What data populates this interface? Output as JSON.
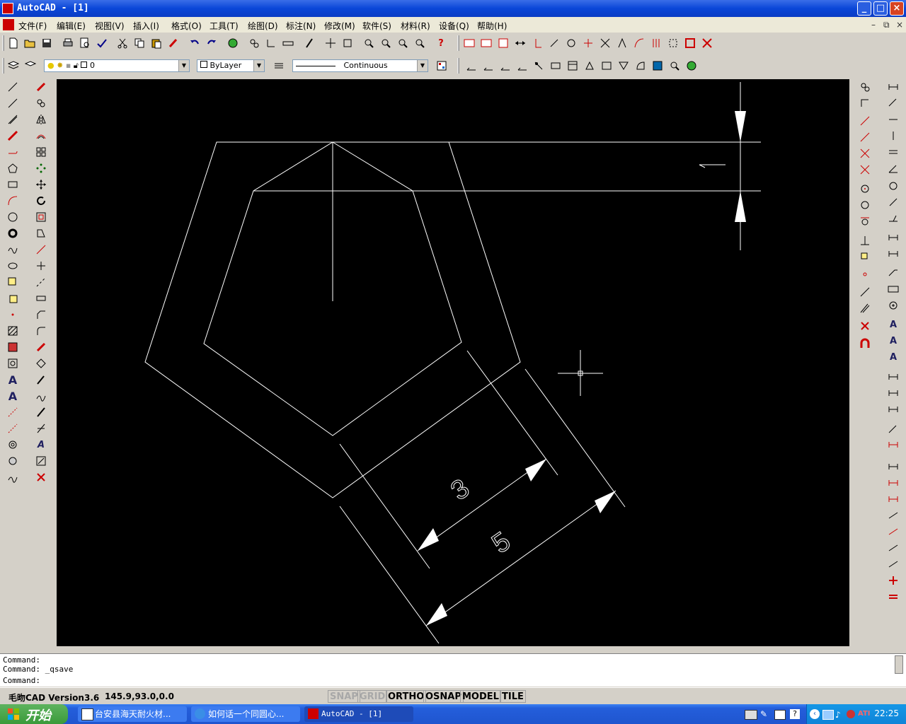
{
  "window": {
    "title": "AutoCAD  - [1]",
    "minimize": "_",
    "maximize": "□",
    "close": "×"
  },
  "menu": {
    "items": [
      "文件(F)",
      "编辑(E)",
      "视图(V)",
      "插入(I)",
      "格式(O)",
      "工具(T)",
      "绘图(D)",
      "标注(N)",
      "修改(M)",
      "软件(S)",
      "材料(R)",
      "设备(Q)",
      "帮助(H)"
    ],
    "mdi": [
      "–",
      "⧉",
      "×"
    ]
  },
  "layer_toolbar": {
    "layer": "0",
    "color": "ByLayer",
    "linetype": "Continuous"
  },
  "drawing": {
    "dim_small": "3",
    "dim_large": "5"
  },
  "command": {
    "lines": [
      "Command:",
      "Command: _qsave",
      "Command:"
    ]
  },
  "status": {
    "version": "毛昒CAD Version3.6",
    "coords": "145.9,93.0,0.0",
    "toggles": [
      {
        "label": "SNAP",
        "on": false
      },
      {
        "label": "GRID",
        "on": false
      },
      {
        "label": "ORTHO",
        "on": true
      },
      {
        "label": "OSNAP",
        "on": true
      },
      {
        "label": "MODEL",
        "on": true
      },
      {
        "label": "TILE",
        "on": true
      }
    ]
  },
  "taskbar": {
    "start": "开始",
    "tasks": [
      {
        "label": "台安县海天耐火材...",
        "active": false
      },
      {
        "label": "如何话一个同圆心...",
        "active": false
      },
      {
        "label": "AutoCAD - [1]",
        "active": true
      }
    ],
    "clock": "22:25"
  }
}
